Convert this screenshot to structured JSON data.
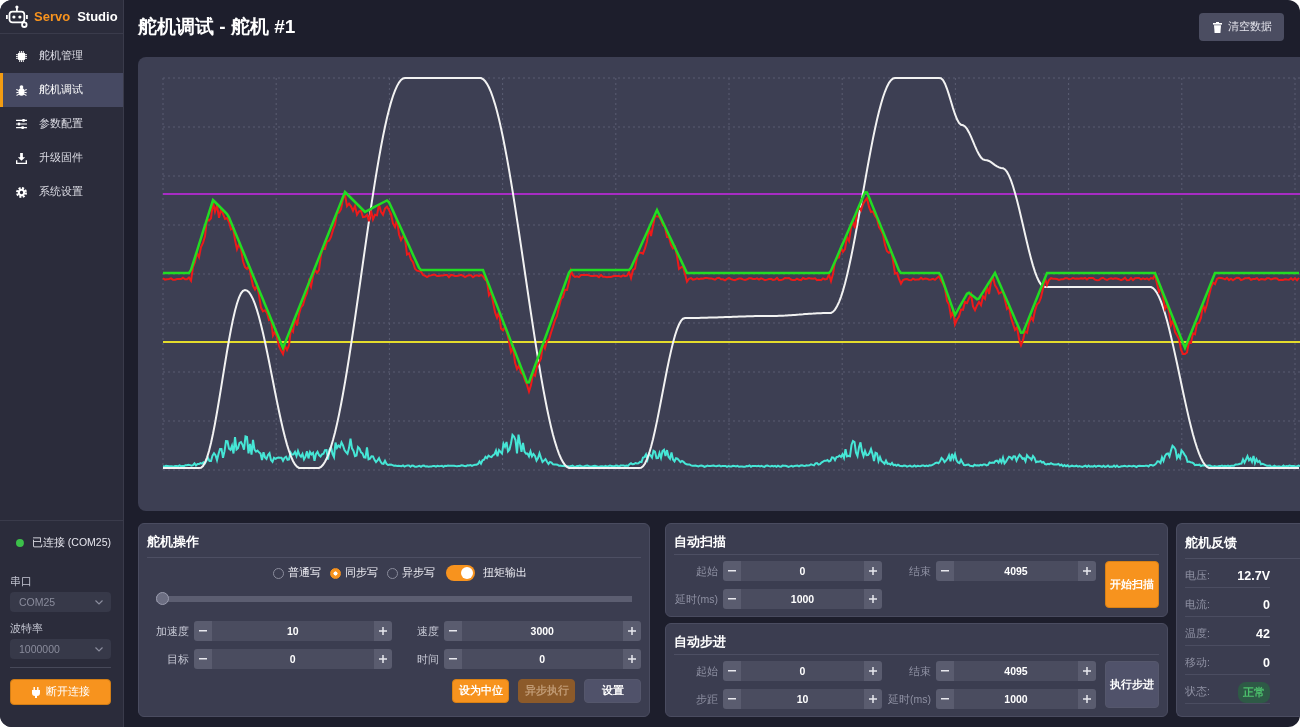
{
  "brand": {
    "accent": "Servo",
    "name": "Studio"
  },
  "sidebar": {
    "items": [
      {
        "label": "舵机管理",
        "selected": false
      },
      {
        "label": "舵机调试",
        "selected": true
      },
      {
        "label": "参数配置",
        "selected": false
      },
      {
        "label": "升级固件",
        "selected": false
      },
      {
        "label": "系统设置",
        "selected": false
      }
    ]
  },
  "connection": {
    "status": "已连接 (COM25)",
    "connected": true,
    "port_select": {
      "label": "串口",
      "value": "COM25",
      "disabled": true
    },
    "baud_select": {
      "label": "波特率",
      "value": "1000000",
      "disabled": true
    },
    "disconnect_button": "断开连接"
  },
  "header": {
    "title": "舵机调试 - 舵机 #1",
    "clear_button": "清空数据"
  },
  "servo_operation": {
    "title": "舵机操作",
    "write_modes": [
      {
        "label": "普通写",
        "selected": false
      },
      {
        "label": "同步写",
        "selected": true
      },
      {
        "label": "异步写",
        "selected": false
      }
    ],
    "torque": {
      "label": "扭矩输出",
      "on": true
    },
    "position_slider": {
      "level": 0
    },
    "fields": [
      {
        "label": "加速度",
        "value": "10"
      },
      {
        "label": "速度",
        "value": "3000"
      },
      {
        "label": "目标",
        "value": "0"
      },
      {
        "label": "时间",
        "value": "0"
      }
    ],
    "buttons": [
      {
        "label": "设为中位",
        "kind": "primary",
        "disabled": false
      },
      {
        "label": "异步执行",
        "kind": "primary",
        "disabled": true
      },
      {
        "label": "设置",
        "kind": "secondary",
        "disabled": false
      }
    ]
  },
  "auto_scan": {
    "title": "自动扫描",
    "fields": [
      {
        "label": "起始",
        "value": "0"
      },
      {
        "label": "结束",
        "value": "4095"
      },
      {
        "label": "延时(ms)",
        "value": "1000"
      }
    ],
    "button": {
      "label": "开始扫描",
      "kind": "primary"
    }
  },
  "auto_step": {
    "title": "自动步进",
    "fields": [
      {
        "label": "起始",
        "value": "0"
      },
      {
        "label": "结束",
        "value": "4095"
      },
      {
        "label": "步距",
        "value": "10"
      },
      {
        "label": "延时(ms)",
        "value": "1000"
      }
    ],
    "button": {
      "label": "执行步进",
      "kind": "secondary"
    }
  },
  "feedback": {
    "title": "舵机反馈",
    "rows": [
      {
        "label": "电压:",
        "value": "12.7V",
        "kind": "value"
      },
      {
        "label": "电流:",
        "value": "0",
        "kind": "value"
      },
      {
        "label": "温度:",
        "value": "42",
        "kind": "value"
      },
      {
        "label": "移动:",
        "value": "0",
        "kind": "value"
      },
      {
        "label": "状态:",
        "value": "正常",
        "kind": "badge"
      }
    ]
  }
}
